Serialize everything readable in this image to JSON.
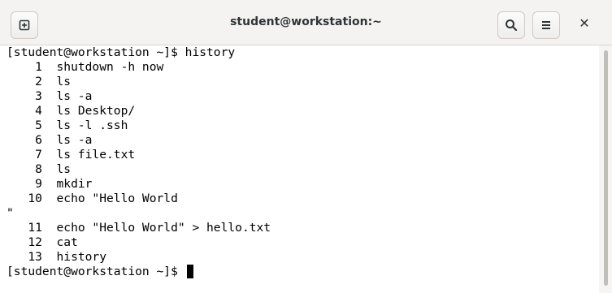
{
  "window": {
    "title": "student@workstation:~",
    "close_glyph": "✕"
  },
  "icons": {
    "new_tab": "new-tab-icon",
    "search": "search-icon",
    "menu": "hamburger-menu-icon",
    "close": "close-icon"
  },
  "terminal": {
    "lines": [
      "[student@workstation ~]$ history",
      "    1  shutdown -h now",
      "    2  ls",
      "    3  ls -a",
      "    4  ls Desktop/",
      "    5  ls -l .ssh",
      "    6  ls -a",
      "    7  ls file.txt",
      "    8  ls",
      "    9  mkdir",
      "   10  echo \"Hello World",
      "\"",
      "   11  echo \"Hello World\" > hello.txt",
      "   12  cat",
      "   13  history"
    ],
    "prompt": "[student@workstation ~]$ "
  }
}
